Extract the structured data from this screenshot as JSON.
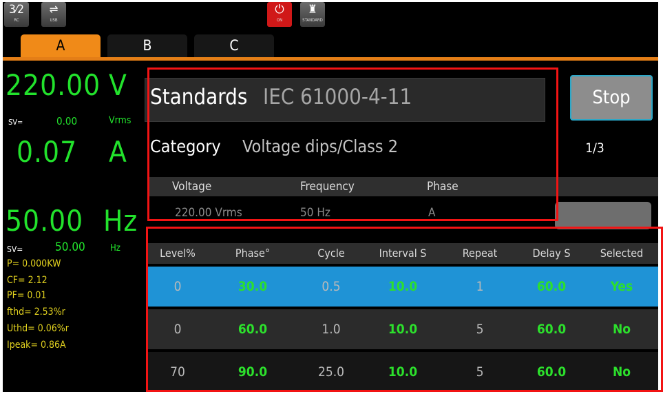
{
  "topbar": {
    "icons": [
      {
        "name": "remote-control-icon",
        "glyph": "3⁄2",
        "caption": "RC"
      },
      {
        "name": "usb-icon",
        "glyph": "⇌",
        "caption": "USB"
      },
      {
        "name": "power-icon",
        "glyph": "⏻",
        "caption": "ON"
      },
      {
        "name": "standard-icon",
        "glyph": "♜",
        "caption": "STANDARD"
      }
    ]
  },
  "channels": {
    "a": "A",
    "b": "B",
    "c": "C",
    "active_color": "#f08a18"
  },
  "measurements": {
    "voltage": "220.00",
    "voltage_unit": "V",
    "voltage_sv_label": "SV=",
    "voltage_sv": "0.00",
    "voltage_sv_unit": "Vrms",
    "current": "0.07",
    "current_unit": "A",
    "frequency": "50.00",
    "frequency_unit": "Hz",
    "frequency_sv_label": "SV=",
    "frequency_sv": "50.00",
    "frequency_sv_unit": "Hz",
    "p": "P= 0.000KW",
    "cf": "CF= 2.12",
    "pf": "PF= 0.01",
    "fthd": "fthd= 2.53%r",
    "uthd": "Uthd= 0.06%r",
    "ipeak": "Ipeak= 0.86A"
  },
  "standards": {
    "label": "Standards",
    "value": "IEC 61000-4-11",
    "category_label": "Category",
    "category_value": "Voltage dips/Class 2",
    "page": "1/3",
    "stop_label": "Stop",
    "sub_headers": [
      "Voltage",
      "Frequency",
      "Phase"
    ],
    "sub_values": [
      "220.00 Vrms",
      "50 Hz",
      "A"
    ]
  },
  "table": {
    "headers": [
      "Level%",
      "Phase°",
      "Cycle",
      "Interval S",
      "Repeat",
      "Delay S",
      "Selected"
    ],
    "rows": [
      [
        "0",
        "30.0",
        "0.5",
        "10.0",
        "1",
        "60.0",
        "Yes"
      ],
      [
        "0",
        "60.0",
        "1.0",
        "10.0",
        "5",
        "60.0",
        "No"
      ],
      [
        "70",
        "90.0",
        "25.0",
        "10.0",
        "5",
        "60.0",
        "No"
      ]
    ]
  },
  "colors": {
    "accent": "#e47e17",
    "measure_green": "#22e22c",
    "measure_yellow": "#e2d21f",
    "selected_row": "#1f93d6",
    "highlight_red": "#f21414"
  }
}
